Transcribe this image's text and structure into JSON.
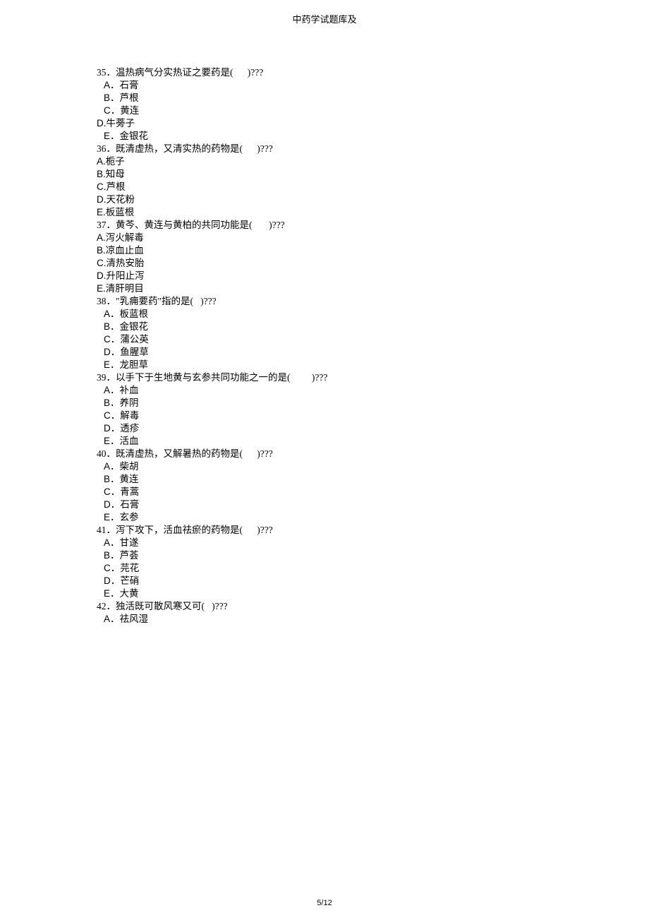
{
  "header": "中药学试题库及",
  "footer": "5/12",
  "questions": [
    {
      "num": "35．",
      "text": "温热病气分实热证之要药是(      )???",
      "indent_options": true,
      "options": [
        {
          "letter": "A．",
          "text": "石膏"
        },
        {
          "letter": "B．",
          "text": "芦根"
        },
        {
          "letter": "C．",
          "text": "黄连"
        },
        {
          "letter": "D.",
          "text": "牛蒡子",
          "tight": true
        },
        {
          "letter": "E．",
          "text": "金银花"
        }
      ]
    },
    {
      "num": "36．",
      "text": "既清虚热，又清实热的药物是(      )???",
      "indent_options": false,
      "options": [
        {
          "letter": "A.",
          "text": "栀子"
        },
        {
          "letter": "B.",
          "text": "知母"
        },
        {
          "letter": "C.",
          "text": "芦根"
        },
        {
          "letter": "D.",
          "text": "天花粉"
        },
        {
          "letter": "E.",
          "text": "板蓝根"
        }
      ]
    },
    {
      "num": "37．",
      "text": "黄芩、黄连与黄柏的共同功能是(       )???",
      "indent_options": false,
      "options": [
        {
          "letter": "A.",
          "text": "泻火解毒"
        },
        {
          "letter": "B.",
          "text": "凉血止血"
        },
        {
          "letter": "C.",
          "text": "清热安胎"
        },
        {
          "letter": "D.",
          "text": "升阳止泻"
        },
        {
          "letter": "E.",
          "text": "清肝明目"
        }
      ]
    },
    {
      "num": "38．",
      "text": "\"乳痈要药\"指的是(   )???",
      "indent_options": true,
      "options": [
        {
          "letter": "A．",
          "text": "板蓝根"
        },
        {
          "letter": "B．",
          "text": "金银花"
        },
        {
          "letter": "C．",
          "text": "蒲公英"
        },
        {
          "letter": "D．",
          "text": "鱼腥草"
        },
        {
          "letter": "E．",
          "text": "龙胆草"
        }
      ]
    },
    {
      "num": "39．",
      "text": "以手下于生地黄与玄参共同功能之一的是(         )???",
      "indent_options": true,
      "options": [
        {
          "letter": "A．",
          "text": "补血"
        },
        {
          "letter": "B．",
          "text": "养阴"
        },
        {
          "letter": "C．",
          "text": "解毒"
        },
        {
          "letter": "D．",
          "text": "透疹"
        },
        {
          "letter": "E．",
          "text": "活血"
        }
      ]
    },
    {
      "num": "40．",
      "text": "既清虚热，又解暑热的药物是(      )???",
      "indent_options": true,
      "options": [
        {
          "letter": "A．",
          "text": "柴胡"
        },
        {
          "letter": "B．",
          "text": "黄连"
        },
        {
          "letter": "C．",
          "text": "青蒿"
        },
        {
          "letter": "D．",
          "text": "石膏"
        },
        {
          "letter": "E．",
          "text": "玄参"
        }
      ]
    },
    {
      "num": "41．",
      "text": "泻下攻下，活血祛瘀的药物是(      )???",
      "indent_options": true,
      "options": [
        {
          "letter": "A．",
          "text": "甘遂"
        },
        {
          "letter": "B．",
          "text": "芦荟"
        },
        {
          "letter": "C．",
          "text": "芫花"
        },
        {
          "letter": "D．",
          "text": "芒硝"
        },
        {
          "letter": "E．",
          "text": "大黄"
        }
      ]
    },
    {
      "num": "42．",
      "text": "独活既可散风寒又可(   )???",
      "indent_options": true,
      "options": [
        {
          "letter": "A．",
          "text": "祛风湿"
        }
      ]
    }
  ]
}
